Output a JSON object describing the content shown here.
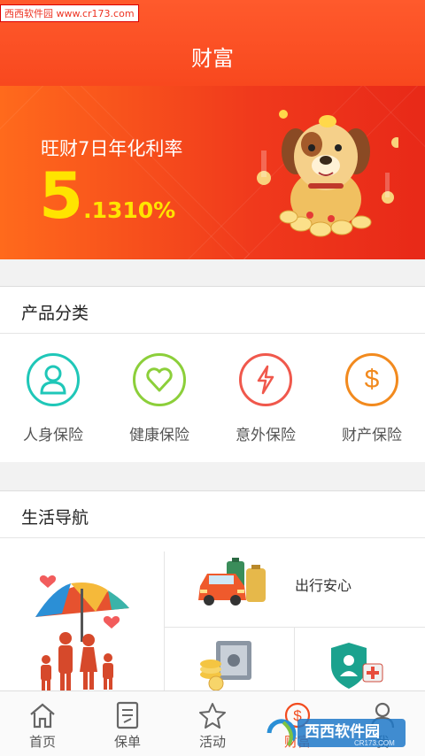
{
  "watermark_top": "西西软件园 www.cr173.com",
  "header": {
    "title": "财富"
  },
  "banner": {
    "label": "旺财7日年化利率",
    "rate_int": "5",
    "rate_dec": ".1310%"
  },
  "categories": {
    "title": "产品分类",
    "items": [
      {
        "label": "人身保险",
        "icon": "person-icon",
        "color": "#1fc7b8"
      },
      {
        "label": "健康保险",
        "icon": "heart-icon",
        "color": "#8ccf3a"
      },
      {
        "label": "意外保险",
        "icon": "lightning-icon",
        "color": "#f0584c"
      },
      {
        "label": "财产保险",
        "icon": "dollar-icon",
        "color": "#f28a1e"
      }
    ]
  },
  "life_nav": {
    "title": "生活导航",
    "travel_label": "出行安心"
  },
  "tabbar": {
    "items": [
      {
        "label": "首页",
        "icon": "home-icon"
      },
      {
        "label": "保单",
        "icon": "policy-icon"
      },
      {
        "label": "活动",
        "icon": "star-icon"
      },
      {
        "label": "财富",
        "icon": "wealth-icon"
      },
      {
        "label": "我",
        "icon": "user-icon"
      }
    ]
  },
  "watermark_br": {
    "brand": "西西软件园",
    "url": "CR173.COM"
  },
  "colors": {
    "primary": "#f8481e",
    "yellow": "#ffe400"
  }
}
